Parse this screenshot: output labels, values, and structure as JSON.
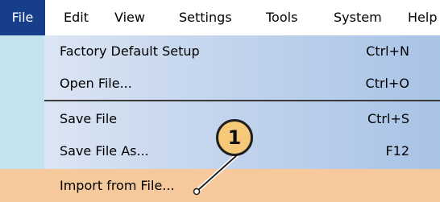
{
  "menubar": {
    "items": [
      {
        "label": "File",
        "active": true
      },
      {
        "label": "Edit"
      },
      {
        "label": "View"
      },
      {
        "label": "Settings"
      },
      {
        "label": "Tools"
      },
      {
        "label": "System"
      },
      {
        "label": "Help"
      }
    ]
  },
  "file_menu": {
    "items": [
      {
        "label": "Factory Default Setup",
        "shortcut": "Ctrl+N"
      },
      {
        "label": "Open File...",
        "shortcut": "Ctrl+O"
      },
      {
        "label": "Save File",
        "shortcut": "Ctrl+S"
      },
      {
        "label": "Save File As...",
        "shortcut": "F12"
      },
      {
        "label": "Import from File...",
        "shortcut": ""
      }
    ]
  },
  "callout": {
    "label": "1"
  },
  "colors": {
    "menubar_active_bg": "#173e8a",
    "highlight_bg": "#f6c99c",
    "callout_fill": "#f6c978",
    "icon_column": "#c3e4ee"
  }
}
